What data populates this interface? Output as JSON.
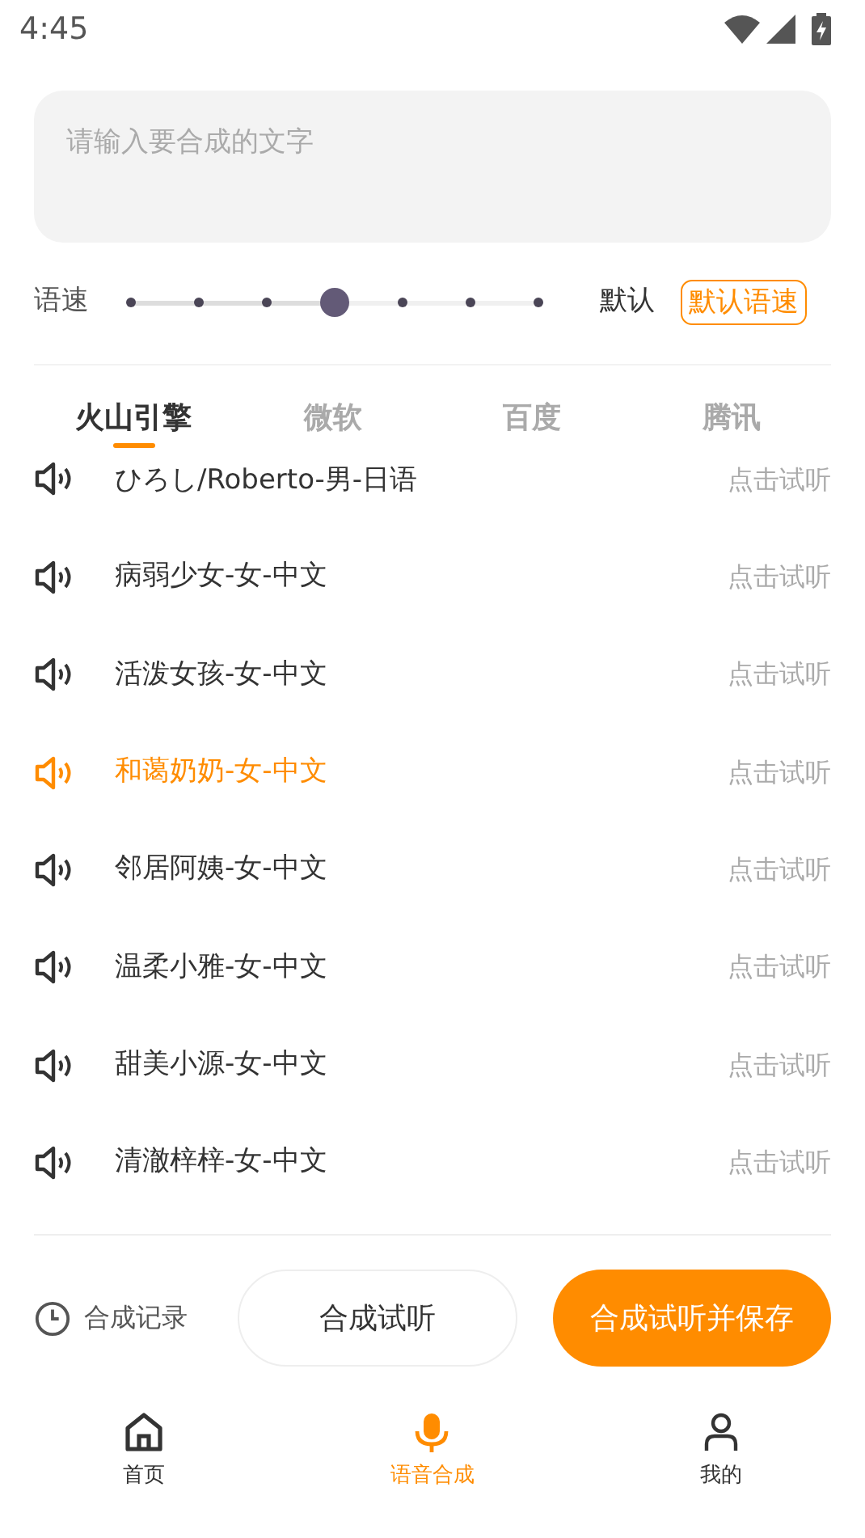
{
  "status_bar": {
    "time": "4:45"
  },
  "text_input": {
    "placeholder": "请输入要合成的文字"
  },
  "speed": {
    "label": "语速",
    "level": 0.5,
    "value_text": "默认",
    "default_button": "默认语速"
  },
  "tabs": [
    {
      "label": "火山引擎",
      "selected": true
    },
    {
      "label": "微软",
      "selected": false
    },
    {
      "label": "百度",
      "selected": false
    },
    {
      "label": "腾讯",
      "selected": false
    }
  ],
  "voices": [
    {
      "name": "ひろし/Roberto-男-日语",
      "selected": false,
      "action": "点击试听"
    },
    {
      "name": "病弱少女-女-中文",
      "selected": false,
      "action": "点击试听"
    },
    {
      "name": "活泼女孩-女-中文",
      "selected": false,
      "action": "点击试听"
    },
    {
      "name": "和蔼奶奶-女-中文",
      "selected": true,
      "action": "点击试听"
    },
    {
      "name": "邻居阿姨-女-中文",
      "selected": false,
      "action": "点击试听"
    },
    {
      "name": "温柔小雅-女-中文",
      "selected": false,
      "action": "点击试听"
    },
    {
      "name": "甜美小源-女-中文",
      "selected": false,
      "action": "点击试听"
    },
    {
      "name": "清澈梓梓-女-中文",
      "selected": false,
      "action": "点击试听"
    }
  ],
  "actions": {
    "history": "合成记录",
    "preview": "合成试听",
    "save": "合成试听并保存"
  },
  "nav": [
    {
      "label": "首页",
      "selected": false
    },
    {
      "label": "语音合成",
      "selected": true
    },
    {
      "label": "我的",
      "selected": false
    }
  ]
}
